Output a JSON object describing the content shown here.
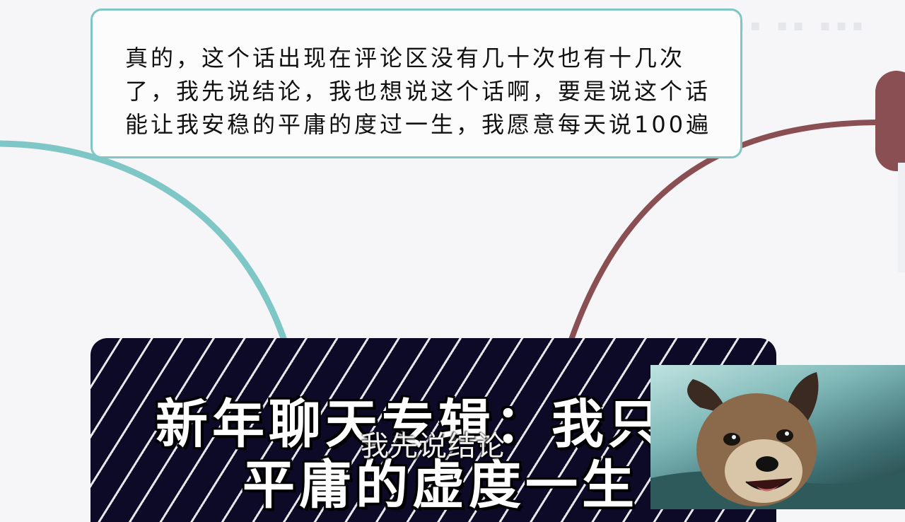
{
  "quote": {
    "lines": [
      "真的，这个话出现在评论区没有几十次也有十几次",
      "了，我先说结论，我也想说这个话啊，要是说这个话",
      "能让我安稳的平庸的度过一生，我愿意每天说100遍"
    ]
  },
  "title": {
    "line1": "新年聊天专辑：我只",
    "line2": "平庸的虚度一生"
  },
  "subtitle": "我先说结论",
  "colors": {
    "teal_curve": "#7fc6c6",
    "maroon_curve": "#8a4f52",
    "banner_bg": "#0c0a26",
    "background": "#f6f6f8"
  }
}
